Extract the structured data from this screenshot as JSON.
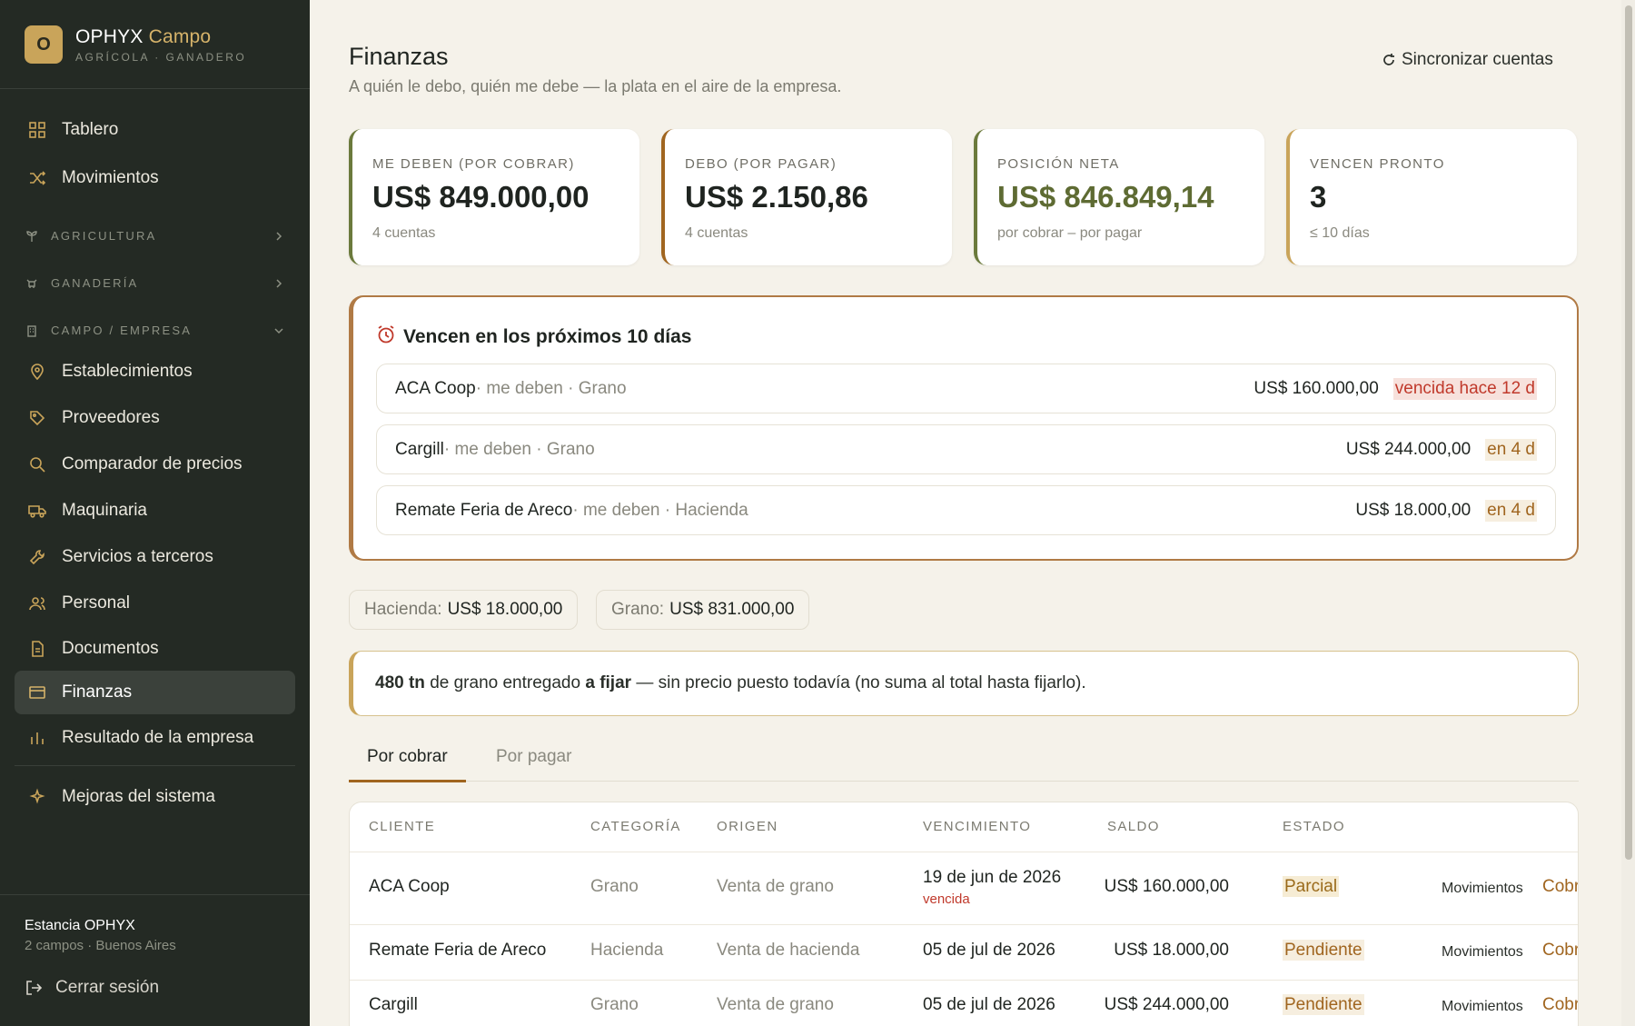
{
  "brand": {
    "logo_letter": "O",
    "name": "OPHYX",
    "name_accent": "Campo",
    "subtitle": "AGRÍCOLA · GANADERO"
  },
  "nav": {
    "tablero": "Tablero",
    "movimientos": "Movimientos",
    "group_agricultura": "AGRICULTURA",
    "group_ganaderia": "GANADERÍA",
    "group_campo": "CAMPO / EMPRESA",
    "establecimientos": "Establecimientos",
    "proveedores": "Proveedores",
    "comparador": "Comparador de precios",
    "maquinaria": "Maquinaria",
    "servicios": "Servicios a terceros",
    "personal": "Personal",
    "documentos": "Documentos",
    "finanzas": "Finanzas",
    "resultado": "Resultado de la empresa",
    "mejoras": "Mejoras del sistema"
  },
  "org": {
    "name": "Estancia OPHYX",
    "sub": "2 campos · Buenos Aires",
    "logout": "Cerrar sesión"
  },
  "header": {
    "title": "Finanzas",
    "subtitle": "A quién le debo, quién me debe — la plata en el aire de la empresa.",
    "sync": "Sincronizar cuentas"
  },
  "kpis": [
    {
      "label": "ME DEBEN (POR COBRAR)",
      "value": "US$ 849.000,00",
      "sub": "4 cuentas",
      "accent": "#6b7a3c",
      "value_color": "#1f2420"
    },
    {
      "label": "DEBO (POR PAGAR)",
      "value": "US$ 2.150,86",
      "sub": "4 cuentas",
      "accent": "#a0651f",
      "value_color": "#1f2420"
    },
    {
      "label": "POSICIÓN NETA",
      "value": "US$ 846.849,14",
      "sub": "por cobrar – por pagar",
      "accent": "#6b7a3c",
      "value_color": "#5e6b33"
    },
    {
      "label": "VENCEN PRONTO",
      "value": "3",
      "sub": "≤ 10 días",
      "accent": "#c9a45a",
      "value_color": "#1f2420"
    }
  ],
  "due": {
    "title": "Vencen en los próximos 10 días",
    "rows": [
      {
        "who": "ACA Coop",
        "meta": " · me deben · Grano",
        "amount": "US$ 160.000,00",
        "badge": "vencida hace 12 d",
        "badge_type": "overdue"
      },
      {
        "who": "Cargill",
        "meta": " · me deben · Grano",
        "amount": "US$ 244.000,00",
        "badge": "en 4 d",
        "badge_type": "soon"
      },
      {
        "who": "Remate Feria de Areco",
        "meta": " · me deben · Hacienda",
        "amount": "US$ 18.000,00",
        "badge": "en 4 d",
        "badge_type": "soon"
      }
    ]
  },
  "chips": [
    {
      "label": "Hacienda:",
      "value": "US$ 18.000,00"
    },
    {
      "label": "Grano:",
      "value": "US$ 831.000,00"
    }
  ],
  "note": {
    "qty": "480 tn",
    "text1": " de grano entregado ",
    "bold": "a fijar",
    "text2": " — sin precio puesto todavía (no suma al total hasta fijarlo)."
  },
  "tabs": {
    "active": "Por cobrar",
    "inactive": "Por pagar"
  },
  "table": {
    "headers": [
      "CLIENTE",
      "CATEGORÍA",
      "ORIGEN",
      "VENCIMIENTO",
      "SALDO",
      "ESTADO"
    ],
    "action_mov": "Movimientos",
    "action_cobrar": "Cobrar",
    "rows": [
      {
        "cliente": "ACA Coop",
        "categoria": "Grano",
        "origen": "Venta de grano",
        "vencimiento": "19 de jun de 2026",
        "venc_note": "vencida",
        "saldo": "US$ 160.000,00",
        "estado": "Parcial"
      },
      {
        "cliente": "Remate Feria de Areco",
        "categoria": "Hacienda",
        "origen": "Venta de hacienda",
        "vencimiento": "05 de jul de 2026",
        "venc_note": "",
        "saldo": "US$ 18.000,00",
        "estado": "Pendiente"
      },
      {
        "cliente": "Cargill",
        "categoria": "Grano",
        "origen": "Venta de grano",
        "vencimiento": "05 de jul de 2026",
        "venc_note": "",
        "saldo": "US$ 244.000,00",
        "estado": "Pendiente"
      }
    ]
  }
}
